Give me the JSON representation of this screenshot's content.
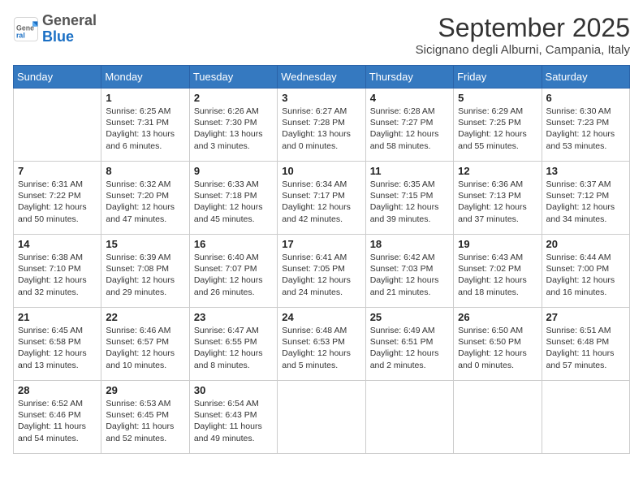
{
  "header": {
    "logo_general": "General",
    "logo_blue": "Blue",
    "month_title": "September 2025",
    "location": "Sicignano degli Alburni, Campania, Italy"
  },
  "days_of_week": [
    "Sunday",
    "Monday",
    "Tuesday",
    "Wednesday",
    "Thursday",
    "Friday",
    "Saturday"
  ],
  "weeks": [
    [
      {
        "day": "",
        "info": ""
      },
      {
        "day": "1",
        "info": "Sunrise: 6:25 AM\nSunset: 7:31 PM\nDaylight: 13 hours\nand 6 minutes."
      },
      {
        "day": "2",
        "info": "Sunrise: 6:26 AM\nSunset: 7:30 PM\nDaylight: 13 hours\nand 3 minutes."
      },
      {
        "day": "3",
        "info": "Sunrise: 6:27 AM\nSunset: 7:28 PM\nDaylight: 13 hours\nand 0 minutes."
      },
      {
        "day": "4",
        "info": "Sunrise: 6:28 AM\nSunset: 7:27 PM\nDaylight: 12 hours\nand 58 minutes."
      },
      {
        "day": "5",
        "info": "Sunrise: 6:29 AM\nSunset: 7:25 PM\nDaylight: 12 hours\nand 55 minutes."
      },
      {
        "day": "6",
        "info": "Sunrise: 6:30 AM\nSunset: 7:23 PM\nDaylight: 12 hours\nand 53 minutes."
      }
    ],
    [
      {
        "day": "7",
        "info": "Sunrise: 6:31 AM\nSunset: 7:22 PM\nDaylight: 12 hours\nand 50 minutes."
      },
      {
        "day": "8",
        "info": "Sunrise: 6:32 AM\nSunset: 7:20 PM\nDaylight: 12 hours\nand 47 minutes."
      },
      {
        "day": "9",
        "info": "Sunrise: 6:33 AM\nSunset: 7:18 PM\nDaylight: 12 hours\nand 45 minutes."
      },
      {
        "day": "10",
        "info": "Sunrise: 6:34 AM\nSunset: 7:17 PM\nDaylight: 12 hours\nand 42 minutes."
      },
      {
        "day": "11",
        "info": "Sunrise: 6:35 AM\nSunset: 7:15 PM\nDaylight: 12 hours\nand 39 minutes."
      },
      {
        "day": "12",
        "info": "Sunrise: 6:36 AM\nSunset: 7:13 PM\nDaylight: 12 hours\nand 37 minutes."
      },
      {
        "day": "13",
        "info": "Sunrise: 6:37 AM\nSunset: 7:12 PM\nDaylight: 12 hours\nand 34 minutes."
      }
    ],
    [
      {
        "day": "14",
        "info": "Sunrise: 6:38 AM\nSunset: 7:10 PM\nDaylight: 12 hours\nand 32 minutes."
      },
      {
        "day": "15",
        "info": "Sunrise: 6:39 AM\nSunset: 7:08 PM\nDaylight: 12 hours\nand 29 minutes."
      },
      {
        "day": "16",
        "info": "Sunrise: 6:40 AM\nSunset: 7:07 PM\nDaylight: 12 hours\nand 26 minutes."
      },
      {
        "day": "17",
        "info": "Sunrise: 6:41 AM\nSunset: 7:05 PM\nDaylight: 12 hours\nand 24 minutes."
      },
      {
        "day": "18",
        "info": "Sunrise: 6:42 AM\nSunset: 7:03 PM\nDaylight: 12 hours\nand 21 minutes."
      },
      {
        "day": "19",
        "info": "Sunrise: 6:43 AM\nSunset: 7:02 PM\nDaylight: 12 hours\nand 18 minutes."
      },
      {
        "day": "20",
        "info": "Sunrise: 6:44 AM\nSunset: 7:00 PM\nDaylight: 12 hours\nand 16 minutes."
      }
    ],
    [
      {
        "day": "21",
        "info": "Sunrise: 6:45 AM\nSunset: 6:58 PM\nDaylight: 12 hours\nand 13 minutes."
      },
      {
        "day": "22",
        "info": "Sunrise: 6:46 AM\nSunset: 6:57 PM\nDaylight: 12 hours\nand 10 minutes."
      },
      {
        "day": "23",
        "info": "Sunrise: 6:47 AM\nSunset: 6:55 PM\nDaylight: 12 hours\nand 8 minutes."
      },
      {
        "day": "24",
        "info": "Sunrise: 6:48 AM\nSunset: 6:53 PM\nDaylight: 12 hours\nand 5 minutes."
      },
      {
        "day": "25",
        "info": "Sunrise: 6:49 AM\nSunset: 6:51 PM\nDaylight: 12 hours\nand 2 minutes."
      },
      {
        "day": "26",
        "info": "Sunrise: 6:50 AM\nSunset: 6:50 PM\nDaylight: 12 hours\nand 0 minutes."
      },
      {
        "day": "27",
        "info": "Sunrise: 6:51 AM\nSunset: 6:48 PM\nDaylight: 11 hours\nand 57 minutes."
      }
    ],
    [
      {
        "day": "28",
        "info": "Sunrise: 6:52 AM\nSunset: 6:46 PM\nDaylight: 11 hours\nand 54 minutes."
      },
      {
        "day": "29",
        "info": "Sunrise: 6:53 AM\nSunset: 6:45 PM\nDaylight: 11 hours\nand 52 minutes."
      },
      {
        "day": "30",
        "info": "Sunrise: 6:54 AM\nSunset: 6:43 PM\nDaylight: 11 hours\nand 49 minutes."
      },
      {
        "day": "",
        "info": ""
      },
      {
        "day": "",
        "info": ""
      },
      {
        "day": "",
        "info": ""
      },
      {
        "day": "",
        "info": ""
      }
    ]
  ]
}
